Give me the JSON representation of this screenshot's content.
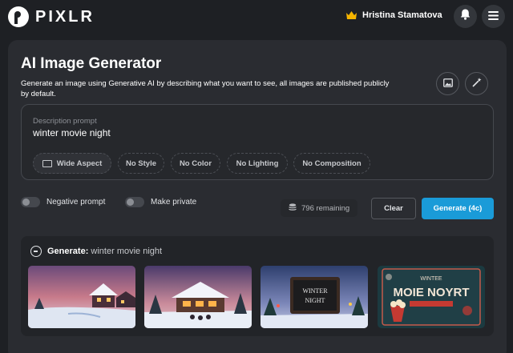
{
  "app": {
    "logo_text": "PIXLR"
  },
  "header": {
    "user_name": "Hristina Stamatova"
  },
  "generator": {
    "title": "AI Image Generator",
    "subtitle": "Generate an image using Generative AI by describing what you want to see, all images are published publicly by default."
  },
  "prompt": {
    "label": "Description prompt",
    "value": "winter movie night"
  },
  "chips": {
    "wide_aspect": "Wide Aspect",
    "no_style": "No Style",
    "no_color": "No Color",
    "no_lighting": "No Lighting",
    "no_composition": "No Composition"
  },
  "options": {
    "negative_prompt": "Negative prompt",
    "make_private": "Make private"
  },
  "credits": {
    "remaining": "796 remaining"
  },
  "actions": {
    "clear": "Clear",
    "generate": "Generate (4c)"
  },
  "results": {
    "heading": "Generate:",
    "query": " winter movie night",
    "thumbnails": [
      "snowy-houses-scene",
      "cabin-night-scene",
      "movie-board-scene",
      "poster-scene"
    ]
  },
  "colors": {
    "accent": "#1a9bd8",
    "background": "#1e2024",
    "panel": "#2a2c31",
    "crown": "#f5b400"
  }
}
